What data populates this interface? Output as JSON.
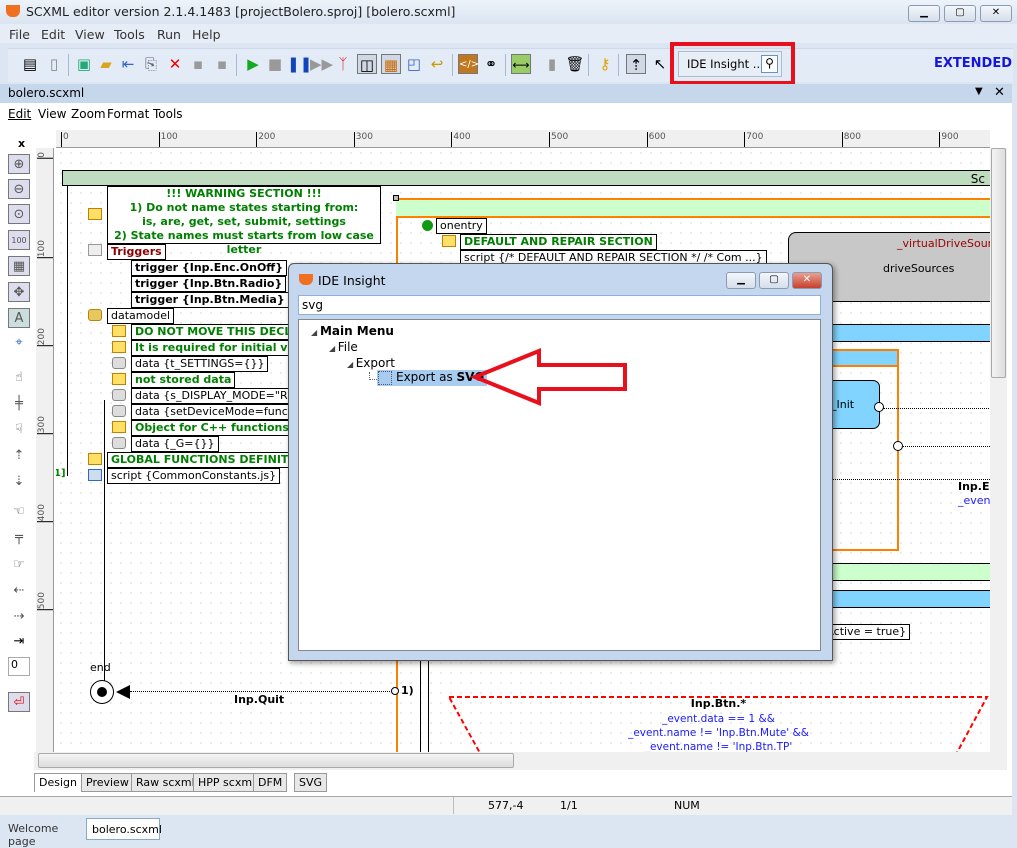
{
  "window": {
    "title": "SCXML editor version 2.1.4.1483 [projectBolero.sproj] [bolero.scxml]",
    "minimize": "▁",
    "maximize": "▢",
    "close": "✕"
  },
  "menu": [
    "File",
    "Edit",
    "View",
    "Tools",
    "Run",
    "Help"
  ],
  "toolbar": {
    "ide_insight_label": "IDE Insight ...",
    "mode": "EXTENDED",
    "accent": "#e8101c"
  },
  "document": {
    "tab_title": "bolero.scxml",
    "menu": [
      "Edit",
      "View",
      "Zoom",
      "Format",
      "Tools"
    ],
    "dropdown": "▼",
    "close": "✕"
  },
  "ruler": {
    "top": [
      "0",
      "100",
      "200",
      "300",
      "400",
      "500",
      "600",
      "700",
      "800",
      "900"
    ],
    "left": [
      "0",
      "100",
      "200",
      "300",
      "400",
      "500"
    ]
  },
  "left_toolbar": {
    "close": "x",
    "value": "0"
  },
  "canvas": {
    "scxml_header": "Sc",
    "warning": [
      "!!! WARNING SECTION !!!",
      "1) Do not name states starting from:",
      "is, are, get, set, submit, settings",
      "2) State names must starts from low case letter"
    ],
    "triggers": "Triggers",
    "trigger_items": [
      "trigger {Inp.Enc.OnOff}",
      "trigger {Inp.Btn.Radio}",
      "trigger {Inp.Btn.Media}"
    ],
    "datamodel": "datamodel",
    "data_items": [
      {
        "text": "DO NOT MOVE THIS DECLARA",
        "type": "comment"
      },
      {
        "text": "It is required for initial value",
        "type": "comment"
      },
      {
        "text": "data {t_SETTINGS={}}",
        "type": "data"
      },
      {
        "text": "not stored data",
        "type": "comment"
      },
      {
        "text": "data {s_DISPLAY_MODE=\"Radio",
        "type": "data"
      },
      {
        "text": "data {setDeviceMode=function(",
        "type": "data"
      },
      {
        "text": "Object for C++ functions to S",
        "type": "comment"
      },
      {
        "text": "data {_G={}}",
        "type": "data"
      }
    ],
    "global_functions": "GLOBAL FUNCTIONS DEFINITION",
    "script_common": "script {CommonConstants.js}",
    "onentry": "onentry",
    "default_repair": "DEFAULT AND REPAIR SECTION",
    "script_default": "script {/* DEFAULT AND REPAIR SECTION */  /* Com ...}",
    "virtual_drive": "_virtualDriveSource",
    "drive_sources": "driveSources",
    "init_state": "_Init",
    "transition_event": "Inp.Er",
    "transition_cond": "_event",
    "active_assign": "tActive = true}",
    "end_label": "end",
    "quit_event": "Inp.Quit",
    "quit_index": "1)",
    "left_index": "1]",
    "btn_event": "Inp.Btn.*",
    "btn_cond": [
      "_event.data == 1 &&",
      "_event.name != 'Inp.Btn.Mute' &&",
      "_event.name != 'Inp.Btn.TP'"
    ]
  },
  "view_tabs": [
    "Design",
    "Preview",
    "Raw scxml",
    "HPP scxml",
    "DFM",
    "SVG"
  ],
  "status": {
    "coords": "577,-4",
    "page": "1/1",
    "num": "NUM"
  },
  "bottom_tabs": [
    "Welcome page",
    "bolero.scxml"
  ],
  "dialog": {
    "title": "IDE Insight",
    "search_value": "svg",
    "tree": {
      "root": "Main Menu",
      "file": "File",
      "export": "Export",
      "item_prefix": "Export as ",
      "item_match": "SVG"
    }
  }
}
